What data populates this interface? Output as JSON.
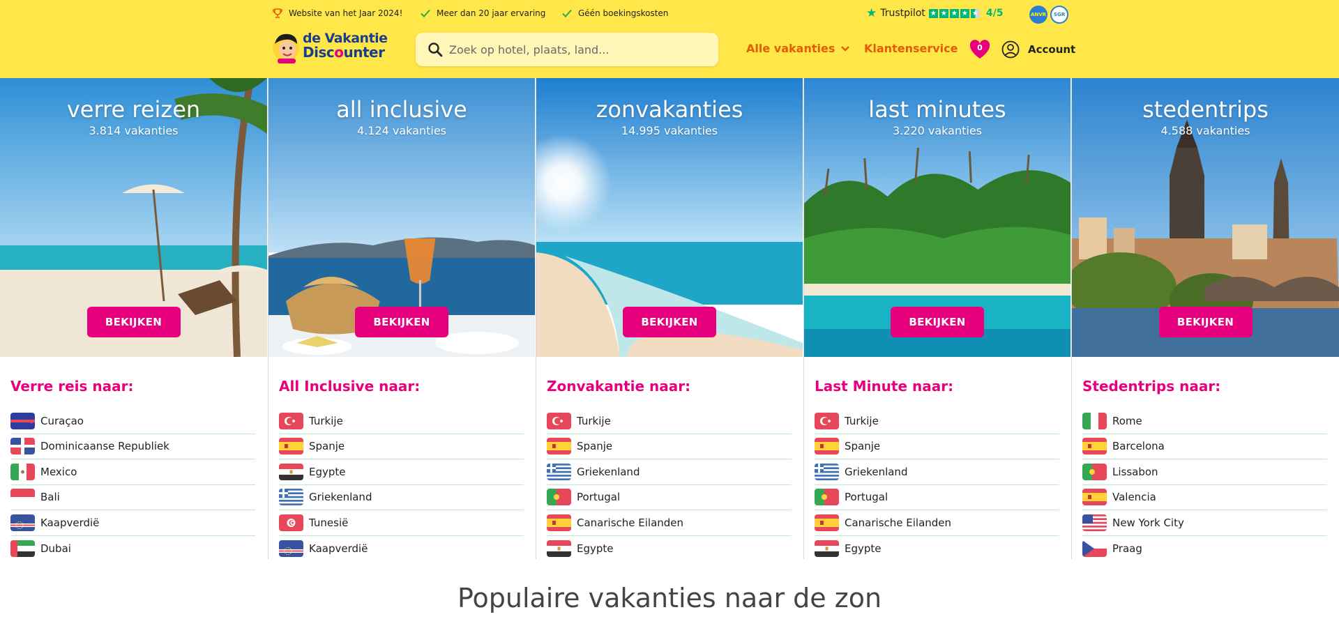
{
  "topbar": {
    "usps": [
      "Website van het Jaar 2024!",
      "Meer dan 20 jaar ervaring",
      "Géén boekingskosten"
    ],
    "trustpilot_label": "Trustpilot",
    "trustpilot_rating": 4.5,
    "trustpilot_score": "4/5",
    "badges": [
      "ANVR",
      "SGR"
    ]
  },
  "header": {
    "logo_line1": "de Vakantie",
    "logo_line2a": "Disc",
    "logo_line2b": "o",
    "logo_line2c": "unter",
    "search_placeholder": "Zoek op hotel, plaats, land...",
    "nav_all": "Alle vakanties",
    "nav_service": "Klantenservice",
    "favorites_count": "0",
    "account": "Account"
  },
  "button_label": "BEKIJKEN",
  "columns": [
    {
      "title": "verre reizen",
      "count": "3.814 vakanties",
      "heading": "Verre reis naar:",
      "destinations": [
        {
          "name": "Curaçao",
          "flag": "curacao"
        },
        {
          "name": "Dominicaanse Republiek",
          "flag": "dominican-republic"
        },
        {
          "name": "Mexico",
          "flag": "mexico"
        },
        {
          "name": "Bali",
          "flag": "indonesia"
        },
        {
          "name": "Kaapverdië",
          "flag": "cape-verde"
        },
        {
          "name": "Dubai",
          "flag": "uae"
        }
      ]
    },
    {
      "title": "all inclusive",
      "count": "4.124 vakanties",
      "heading": "All Inclusive naar:",
      "destinations": [
        {
          "name": "Turkije",
          "flag": "turkey"
        },
        {
          "name": "Spanje",
          "flag": "spain"
        },
        {
          "name": "Egypte",
          "flag": "egypt"
        },
        {
          "name": "Griekenland",
          "flag": "greece"
        },
        {
          "name": "Tunesië",
          "flag": "tunisia"
        },
        {
          "name": "Kaapverdië",
          "flag": "cape-verde"
        }
      ]
    },
    {
      "title": "zonvakanties",
      "count": "14.995 vakanties",
      "heading": "Zonvakantie naar:",
      "destinations": [
        {
          "name": "Turkije",
          "flag": "turkey"
        },
        {
          "name": "Spanje",
          "flag": "spain"
        },
        {
          "name": "Griekenland",
          "flag": "greece"
        },
        {
          "name": "Portugal",
          "flag": "portugal"
        },
        {
          "name": "Canarische Eilanden",
          "flag": "spain"
        },
        {
          "name": "Egypte",
          "flag": "egypt"
        }
      ]
    },
    {
      "title": "last minutes",
      "count": "3.220 vakanties",
      "heading": "Last Minute naar:",
      "destinations": [
        {
          "name": "Turkije",
          "flag": "turkey"
        },
        {
          "name": "Spanje",
          "flag": "spain"
        },
        {
          "name": "Griekenland",
          "flag": "greece"
        },
        {
          "name": "Portugal",
          "flag": "portugal"
        },
        {
          "name": "Canarische Eilanden",
          "flag": "spain"
        },
        {
          "name": "Egypte",
          "flag": "egypt"
        }
      ]
    },
    {
      "title": "stedentrips",
      "count": "4.588 vakanties",
      "heading": "Stedentrips naar:",
      "destinations": [
        {
          "name": "Rome",
          "flag": "italy"
        },
        {
          "name": "Barcelona",
          "flag": "spain"
        },
        {
          "name": "Lissabon",
          "flag": "portugal"
        },
        {
          "name": "Valencia",
          "flag": "spain"
        },
        {
          "name": "New York City",
          "flag": "usa"
        },
        {
          "name": "Praag",
          "flag": "czech"
        }
      ]
    }
  ],
  "section_title": "Populaire vakanties naar de zon",
  "colors": {
    "header_bg": "#ffe749",
    "accent_pink": "#e6007e",
    "nav_orange": "#e65a00",
    "trustpilot_green": "#00b67a"
  }
}
